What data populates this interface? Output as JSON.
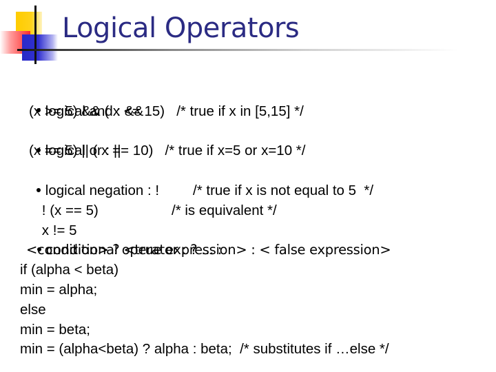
{
  "slide": {
    "title": "Logical Operators",
    "colors": {
      "title": "#2b2b83",
      "logo_yellow": "#ffcc00",
      "logo_red": "#ff2b2b",
      "logo_blue": "#2a2ac8",
      "text": "#000000"
    },
    "sections": {
      "and": {
        "heading": "logical and : &&",
        "code": "(x >= 5) && ( x <= 15)   /* true if x in [5,15] */"
      },
      "or": {
        "heading": "logical or : ||",
        "code": "(x == 5) || ( x == 10)   /* true if x=5 or x=10 */"
      },
      "not": {
        "heading": "logical negation : !",
        "code1": "! (x == 5)",
        "comment1": "/* true if x is not equal to 5  */",
        "code2": "x != 5",
        "comment2": "/* is equivalent */"
      },
      "conditional": {
        "heading": "conditional operator : ? ... :",
        "syntax": "<condition> ? <true expression> : < false expression>"
      }
    },
    "example_lines": [
      "if (alpha < beta)",
      "min = alpha;",
      "else",
      "min = beta;",
      "min = (alpha<beta) ? alpha : beta;  /* substitutes if …else */"
    ]
  }
}
